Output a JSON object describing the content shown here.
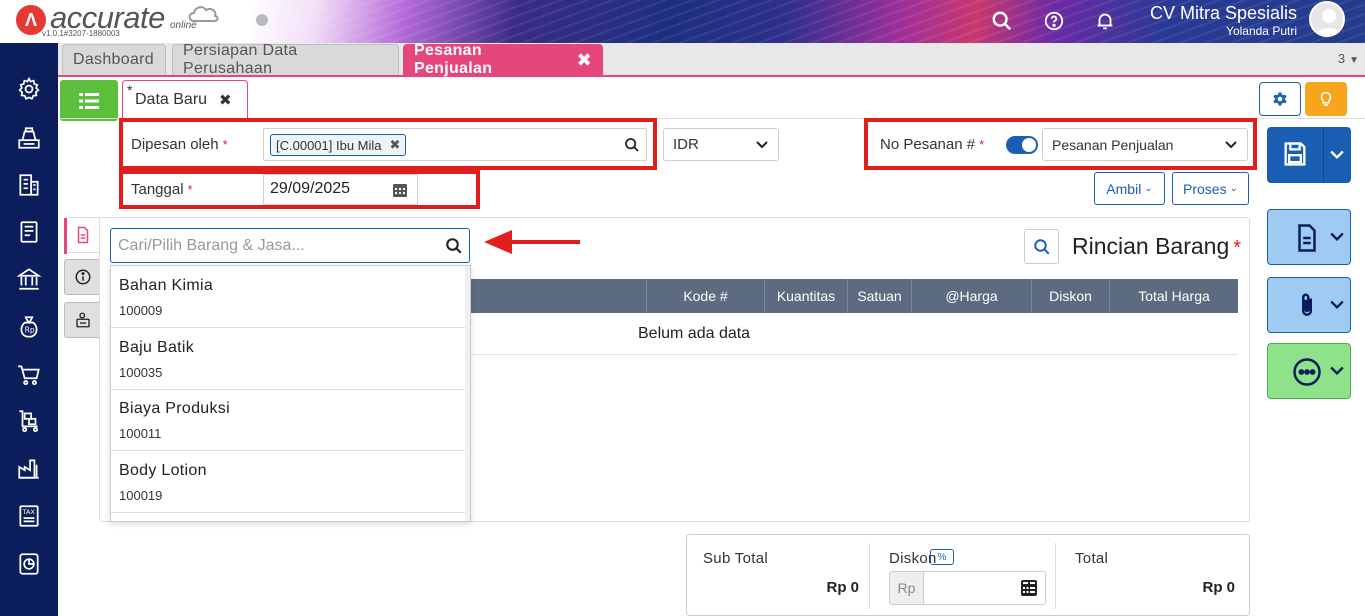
{
  "header": {
    "logo_word": "accurate",
    "logo_online": "online",
    "version": "v1.0.1#3207-1880003",
    "company_name": "CV Mitra Spesialis",
    "user_name": "Yolanda Putri"
  },
  "tabs": [
    {
      "label": "Dashboard"
    },
    {
      "label": "Persiapan Data Perusahaan"
    },
    {
      "label": "Pesanan Penjualan",
      "close": "✖"
    }
  ],
  "tab_count": "3",
  "subtab": {
    "star": "*",
    "label": "Data Baru",
    "close": "✖"
  },
  "form": {
    "dipesan_oleh_label": "Dipesan oleh",
    "required_mark": "*",
    "customer_chip": "[C.00001] Ibu Mila",
    "chip_close": "✖",
    "currency": "IDR",
    "no_pesanan_label": "No Pesanan #",
    "no_pesanan_type": "Pesanan Penjualan",
    "tanggal_label": "Tanggal",
    "tanggal_value": "29/09/2025",
    "ambil_label": "Ambil",
    "proses_label": "Proses"
  },
  "detail": {
    "search_placeholder": "Cari/Pilih Barang & Jasa...",
    "title": "Rincian Barang",
    "columns": [
      "Kode #",
      "Kuantitas",
      "Satuan",
      "@Harga",
      "Diskon",
      "Total Harga"
    ],
    "empty_text": "Belum ada data",
    "dropdown_items": [
      {
        "name": "Bahan Kimia",
        "code": "100009"
      },
      {
        "name": "Baju Batik",
        "code": "100035"
      },
      {
        "name": "Biaya Produksi",
        "code": "100011"
      },
      {
        "name": "Body Lotion",
        "code": "100019"
      }
    ]
  },
  "totals": {
    "sub_total_label": "Sub Total",
    "sub_total_value": "Rp 0",
    "diskon_label": "Diskon",
    "diskon_pct": "%",
    "diskon_prefix": "Rp",
    "total_label": "Total",
    "total_value": "Rp 0"
  },
  "colors": {
    "accent_pink": "#e6477b",
    "primary_blue": "#1a5fb4",
    "sidebar_navy": "#0b1e5b",
    "highlight_red": "#e01e1e",
    "list_green": "#5cbf3c"
  },
  "icons": {
    "sidebar": [
      "gear-icon",
      "cashier-icon",
      "building-icon",
      "ledger-icon",
      "bank-icon",
      "money-bag-icon",
      "cart-icon",
      "inventory-cart-icon",
      "factory-icon",
      "tax-icon",
      "report-icon"
    ],
    "header": [
      "search-icon",
      "help-icon",
      "bell-icon"
    ]
  }
}
